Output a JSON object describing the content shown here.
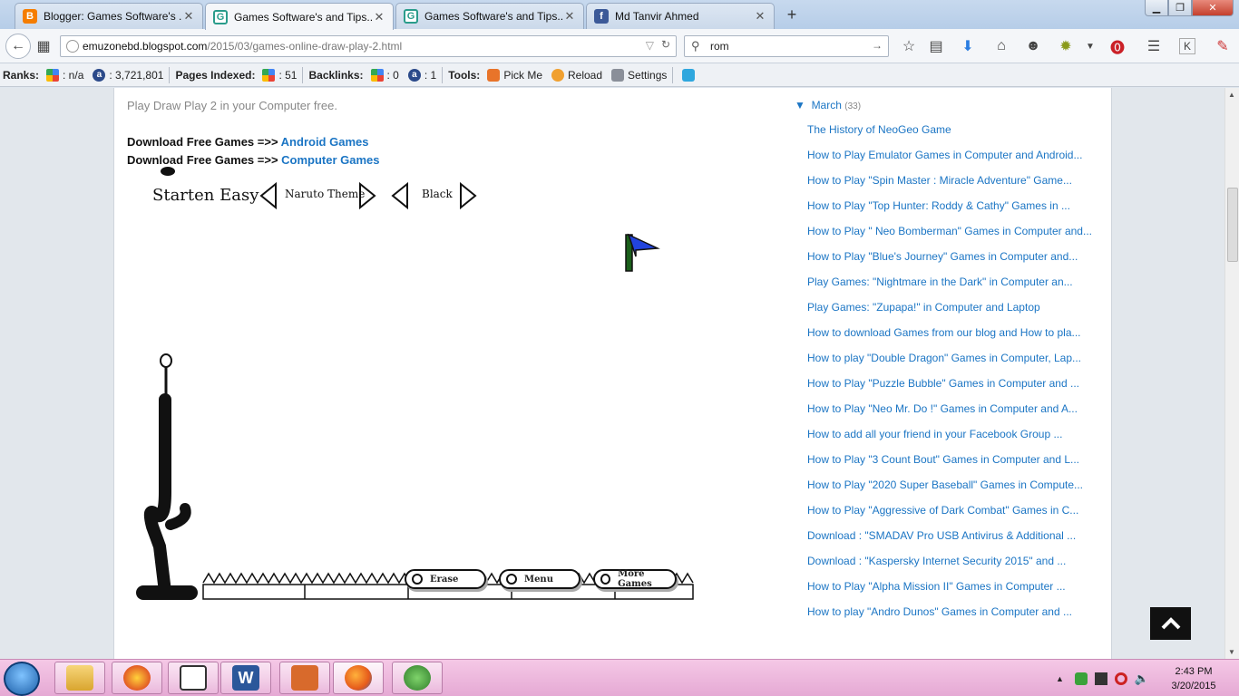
{
  "tabs": [
    {
      "title": "Blogger: Games Software's ...",
      "icon": "blogger-icon",
      "active": false
    },
    {
      "title": "Games Software's and Tips...",
      "icon": "g-site-icon",
      "active": true
    },
    {
      "title": "Games Software's and Tips...",
      "icon": "g-site-icon",
      "active": false
    },
    {
      "title": "Md Tanvir Ahmed",
      "icon": "facebook-icon",
      "active": false
    }
  ],
  "nav": {
    "url_host": "emuzonebd.blogspot.com",
    "url_path": "/2015/03/games-online-draw-play-2.html",
    "search_value": "rom"
  },
  "seobar": {
    "ranks_label": "Ranks:",
    "rank_google": ": n/a",
    "rank_alexa": ": 3,721,801",
    "pages_label": "Pages Indexed:",
    "pages_value": ": 51",
    "backlinks_label": "Backlinks:",
    "backlinks_google": ": 0",
    "backlinks_alexa": ": 1",
    "tools_label": "Tools:",
    "pickme": "Pick Me",
    "reload": "Reload",
    "settings": "Settings"
  },
  "post": {
    "intro": "Play Draw Play 2 in your Computer free.",
    "dl_prefix": "Download Free Games =>> ",
    "dl1_link": "Android Games",
    "dl2_link": "Computer Games"
  },
  "game": {
    "level": "Starten Easy",
    "theme": "Naruto Theme",
    "color": "Black",
    "btn_erase": "Erase",
    "btn_menu": "Menu",
    "btn_more": "More Games"
  },
  "archive": {
    "month": "March",
    "count": "(33)",
    "posts": [
      "The History of NeoGeo Game",
      "How to Play Emulator Games in Computer and Android...",
      "How to Play \"Spin Master : Miracle Adventure\" Game...",
      "How to Play \"Top Hunter: Roddy & Cathy\" Games in ...",
      "How to Play \" Neo Bomberman\" Games in Computer and...",
      "How to Play \"Blue's Journey\" Games in Computer and...",
      "Play Games: \"Nightmare in the Dark\" in Computer an...",
      "Play Games: \"Zupapa!\" in Computer and Laptop",
      "How to download Games from our blog and How to pla...",
      "How to play \"Double Dragon\" Games in Computer, Lap...",
      "How to Play \"Puzzle Bubble\" Games in Computer and ...",
      "How to Play \"Neo Mr. Do !\" Games in Computer and A...",
      "How to add all your friend in your Facebook Group ...",
      "How to Play \"3 Count Bout\" Games in Computer and L...",
      "How to Play \"2020 Super Baseball\" Games in Compute...",
      "How to Play \"Aggressive of Dark Combat\" Games in C...",
      "Download : \"SMADAV Pro USB Antivirus & Additional ...",
      "Download : \"Kaspersky Internet Security 2015\" and ...",
      "How to Play \"Alpha Mission II\" Games in Computer ...",
      "How to play \"Andro Dunos\" Games in Computer and ..."
    ]
  },
  "clock": {
    "time": "2:43 PM",
    "date": "3/20/2015"
  },
  "colors": {
    "link": "#1b75c4",
    "taskbar": "#e5a9d4"
  }
}
